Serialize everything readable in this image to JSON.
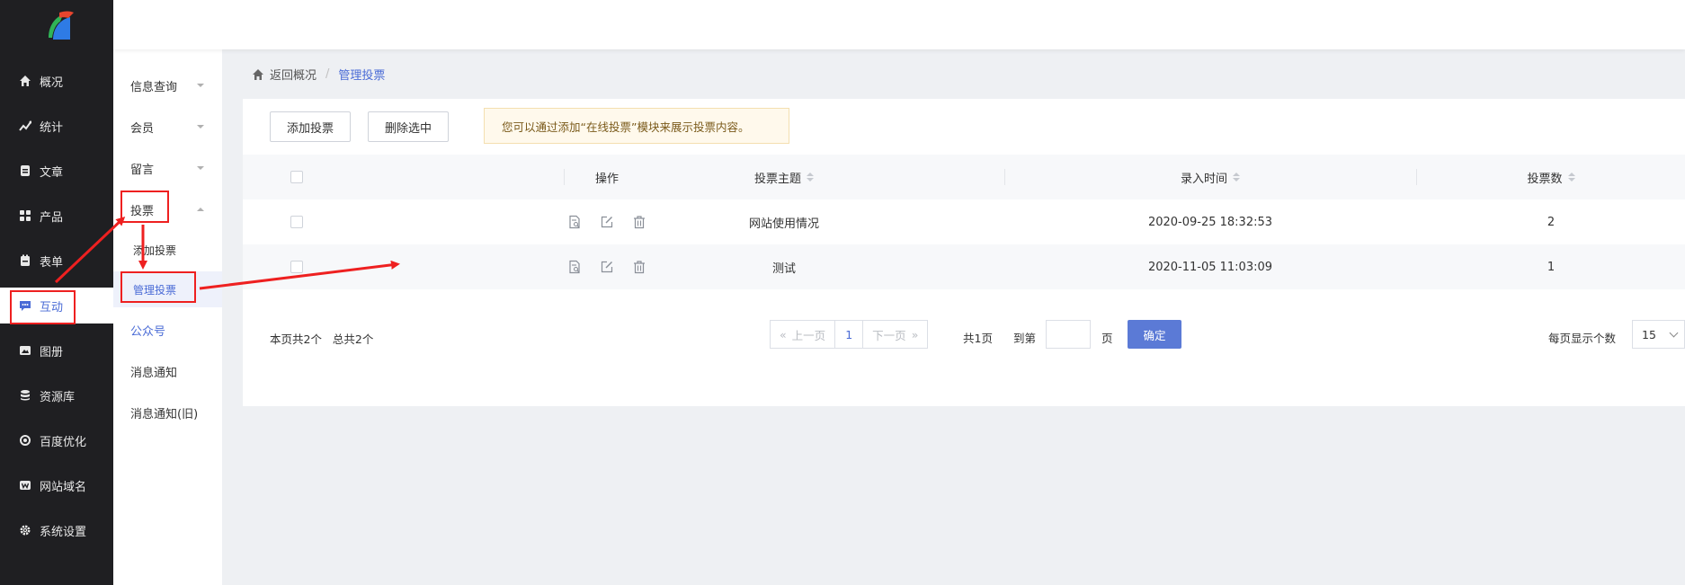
{
  "colors": {
    "sidebar_bg": "#1f1f22",
    "accent": "#4a6bd6",
    "confirm_bg": "#5b7ad6",
    "annotation": "#ee2020"
  },
  "main_nav": {
    "items": [
      {
        "label": "概况",
        "icon": "home-icon"
      },
      {
        "label": "统计",
        "icon": "chart-icon"
      },
      {
        "label": "文章",
        "icon": "article-icon"
      },
      {
        "label": "产品",
        "icon": "grid-icon"
      },
      {
        "label": "表单",
        "icon": "form-icon"
      },
      {
        "label": "互动",
        "icon": "chat-icon",
        "active": true
      },
      {
        "label": "图册",
        "icon": "album-icon"
      },
      {
        "label": "资源库",
        "icon": "database-icon"
      },
      {
        "label": "百度优化",
        "icon": "seo-icon"
      },
      {
        "label": "网站域名",
        "icon": "domain-icon"
      },
      {
        "label": "系统设置",
        "icon": "gear-icon"
      }
    ]
  },
  "sub_nav": {
    "items": [
      {
        "label": "信息查询"
      },
      {
        "label": "会员"
      },
      {
        "label": "留言"
      },
      {
        "label": "投票",
        "expanded": true
      },
      {
        "label": "添加投票"
      },
      {
        "label": "管理投票",
        "selected": true
      },
      {
        "label": "公众号"
      },
      {
        "label": "消息通知"
      },
      {
        "label": "消息通知(旧)"
      }
    ]
  },
  "breadcrumb": {
    "back": "返回概况",
    "separator": "/",
    "current": "管理投票"
  },
  "toolbar": {
    "add_label": "添加投票",
    "delete_label": "删除选中",
    "tip": "您可以通过添加“在线投票”模块来展示投票内容。"
  },
  "table": {
    "headers": {
      "actions": "操作",
      "topic": "投票主题",
      "time": "录入时间",
      "count": "投票数"
    },
    "rows": [
      {
        "topic": "网站使用情况",
        "time": "2020-09-25 18:32:53",
        "count": "2"
      },
      {
        "topic": "测试",
        "time": "2020-11-05 11:03:09",
        "count": "1"
      }
    ]
  },
  "pagination": {
    "summary_page": "本页共2个",
    "summary_total": "总共2个",
    "prev": "上一页",
    "current_page": "1",
    "next": "下一页",
    "total_pages": "共1页",
    "goto_label": "到第",
    "page_unit": "页",
    "confirm": "确定",
    "per_page_label": "每页显示个数",
    "per_page_value": "15"
  }
}
